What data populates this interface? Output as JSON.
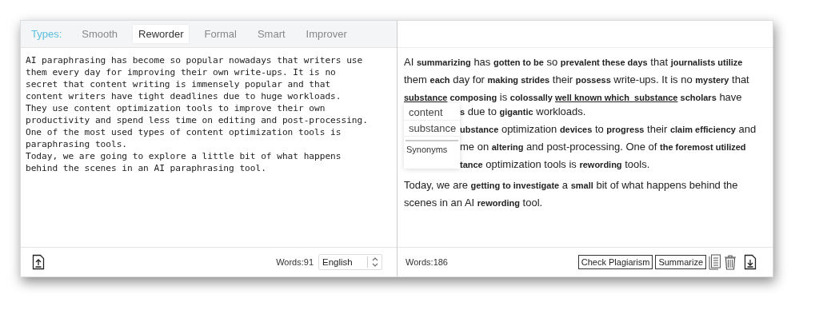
{
  "types_label": "Types:",
  "tabs": [
    {
      "label": "Smooth",
      "selected": false
    },
    {
      "label": "Reworder",
      "selected": true
    },
    {
      "label": "Formal",
      "selected": false
    },
    {
      "label": "Smart",
      "selected": false
    },
    {
      "label": "Improver",
      "selected": false
    }
  ],
  "input": {
    "lines": [
      "AI paraphrasing has become so popular nowadays that writers use",
      "them every day for improving their own write-ups. It is no",
      "secret that content writing is immensely popular and that",
      "content writers have tight deadlines due to huge workloads.",
      "They use content optimization tools to improve their own",
      "productivity and spend less time on editing and post-processing.",
      "One of the most used types of content optimization tools is",
      "paraphrasing tools.",
      "Today, we are going to explore a little bit of what happens",
      "behind the scenes in an AI paraphrasing tool."
    ],
    "word_count": "Words:91",
    "language": "English"
  },
  "output": {
    "lines_before": [
      [
        {
          "text": "AI ",
          "kind": "plain"
        },
        {
          "text": "summarizing",
          "kind": "changed"
        },
        {
          "text": " has ",
          "kind": "plain"
        },
        {
          "text": "gotten to be",
          "kind": "changed"
        },
        {
          "text": " so ",
          "kind": "plain"
        },
        {
          "text": "prevalent these days",
          "kind": "changed"
        },
        {
          "text": " that ",
          "kind": "plain"
        },
        {
          "text": "journalists utilize",
          "kind": "changed"
        }
      ],
      [
        {
          "text": "them ",
          "kind": "plain"
        },
        {
          "text": "each",
          "kind": "changed"
        },
        {
          "text": " day for ",
          "kind": "plain"
        },
        {
          "text": "making strides",
          "kind": "changed"
        },
        {
          "text": " their ",
          "kind": "plain"
        },
        {
          "text": "possess",
          "kind": "changed"
        },
        {
          "text": " write-ups. It is no ",
          "kind": "plain"
        },
        {
          "text": "mystery",
          "kind": "changed"
        },
        {
          "text": " that",
          "kind": "plain"
        }
      ],
      [
        {
          "text": "substance",
          "kind": "flagged"
        },
        {
          "text": " composing",
          "kind": "changed"
        },
        {
          "text": " is ",
          "kind": "plain"
        },
        {
          "text": "colossally ",
          "kind": "changed"
        },
        {
          "text": "well known which  substance",
          "kind": "flagged"
        },
        {
          "text": " scholars",
          "kind": "changed"
        },
        {
          "text": " have",
          "kind": "plain"
        }
      ]
    ],
    "lines_beside": [
      [
        {
          "text": "s",
          "kind": "changed"
        },
        {
          "text": " due to ",
          "kind": "plain"
        },
        {
          "text": "gigantic",
          "kind": "changed"
        },
        {
          "text": " workloads.",
          "kind": "plain"
        }
      ],
      [
        {
          "text": "ubstance",
          "kind": "changed"
        },
        {
          "text": " optimization ",
          "kind": "plain"
        },
        {
          "text": "devices",
          "kind": "changed"
        },
        {
          "text": " to ",
          "kind": "plain"
        },
        {
          "text": "progress",
          "kind": "changed"
        },
        {
          "text": " their ",
          "kind": "plain"
        },
        {
          "text": "claim efficiency",
          "kind": "changed"
        },
        {
          "text": " and",
          "kind": "plain"
        }
      ],
      [
        {
          "text": "me on ",
          "kind": "plain"
        },
        {
          "text": "altering",
          "kind": "changed"
        },
        {
          "text": " and post-processing. One of ",
          "kind": "plain"
        },
        {
          "text": "the foremost utilized",
          "kind": "changed"
        }
      ],
      [
        {
          "text": "tance",
          "kind": "changed"
        },
        {
          "text": " optimization tools is ",
          "kind": "plain"
        },
        {
          "text": "rewording",
          "kind": "changed"
        },
        {
          "text": " tools.",
          "kind": "plain"
        }
      ]
    ],
    "lines_after": [
      [
        {
          "text": "Today, we are ",
          "kind": "plain"
        },
        {
          "text": "getting to investigate",
          "kind": "changed"
        },
        {
          "text": " a ",
          "kind": "plain"
        },
        {
          "text": "small",
          "kind": "changed"
        },
        {
          "text": " bit of what happens behind the",
          "kind": "plain"
        }
      ],
      [
        {
          "text": "scenes in an AI ",
          "kind": "plain"
        },
        {
          "text": "rewording",
          "kind": "changed"
        },
        {
          "text": " tool.",
          "kind": "plain"
        }
      ]
    ],
    "popup": {
      "options": [
        "content",
        "substance"
      ],
      "footer": "Synonyms"
    },
    "word_count": "Words:186",
    "buttons": [
      "Check Plagiarism",
      "Summarize"
    ]
  }
}
